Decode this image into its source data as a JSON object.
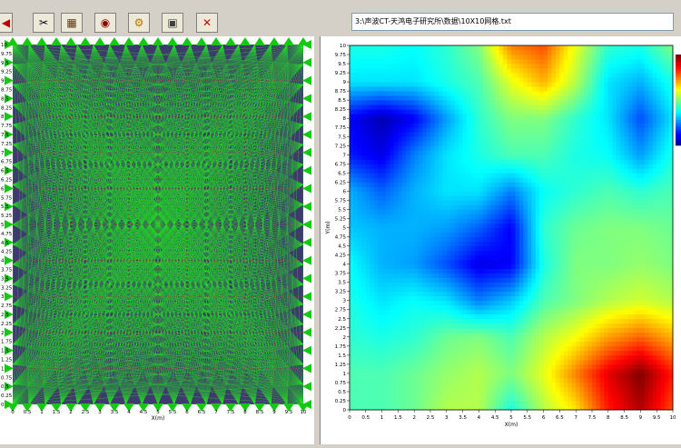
{
  "toolbar": {
    "buttons": [
      {
        "name": "open-file-button",
        "glyph": "≡"
      },
      {
        "name": "tools-button",
        "glyph": "✂"
      },
      {
        "name": "mesh-button",
        "glyph": "▦"
      },
      {
        "name": "contour-button",
        "glyph": "◉"
      },
      {
        "name": "settings-button",
        "glyph": "⚙"
      },
      {
        "name": "export-button",
        "glyph": "▣"
      },
      {
        "name": "close-button",
        "glyph": "✕"
      }
    ],
    "partial_icon_glyph": "◀"
  },
  "path": "3:\\声波CT-天鸿电子研究所\\数据\\10X10网格.txt",
  "colors": {
    "mesh_line": "#22e022",
    "mesh_bg": "#3f3a6e",
    "triangle": "#14c814",
    "grid_dot": "#c04040"
  },
  "chart_data": [
    {
      "type": "scatter",
      "xlabel": "X(m)",
      "ylabel": "",
      "xlim": [
        0,
        10
      ],
      "ylim": [
        0,
        10
      ],
      "x_ticks": [
        "0",
        "0.5",
        "1",
        "1.5",
        "2",
        "2.5",
        "3",
        "3.5",
        "4",
        "4.5",
        "5",
        "5.5",
        "6",
        "6.5",
        "7",
        "7.5",
        "8",
        "8.5",
        "9",
        "9.5",
        "10"
      ],
      "y_ticks": [
        "0",
        "0.25",
        "0.5",
        "0.75",
        "1",
        "1.25",
        "1.5",
        "1.75",
        "2",
        "2.25",
        "2.5",
        "2.75",
        "3",
        "3.25",
        "3.5",
        "3.75",
        "4",
        "4.25",
        "4.5",
        "4.75",
        "5",
        "5.25",
        "5.5",
        "5.75",
        "6",
        "6.25",
        "6.5",
        "6.75",
        "7",
        "7.25",
        "7.5",
        "7.75",
        "8",
        "8.25",
        "8.5",
        "8.75",
        "9",
        "9.25",
        "9.5",
        "9.75",
        "10"
      ],
      "grid": true
    },
    {
      "type": "heatmap",
      "xlabel": "X(m)",
      "ylabel": "Y(m)",
      "xlim": [
        0,
        10
      ],
      "ylim": [
        0,
        10
      ],
      "x_ticks": [
        "0",
        "0.5",
        "1",
        "1.5",
        "2",
        "2.5",
        "3",
        "3.5",
        "4",
        "4.5",
        "5",
        "5.5",
        "6",
        "6.5",
        "7",
        "7.5",
        "8",
        "8.5",
        "9",
        "9.5",
        "10"
      ],
      "y_ticks": [
        "0",
        "0.25",
        "0.5",
        "0.75",
        "1",
        "1.25",
        "1.5",
        "1.75",
        "2",
        "2.25",
        "2.5",
        "2.75",
        "3",
        "3.25",
        "3.5",
        "3.75",
        "4",
        "4.25",
        "4.5",
        "4.75",
        "5",
        "5.25",
        "5.5",
        "5.75",
        "6",
        "6.25",
        "6.5",
        "6.75",
        "7",
        "7.25",
        "7.5",
        "7.75",
        "8",
        "8.25",
        "8.5",
        "8.75",
        "9",
        "9.25",
        "9.5",
        "9.75",
        "10"
      ],
      "grid_x": [
        0,
        1,
        2,
        3,
        4,
        5,
        6,
        7,
        8,
        9,
        10
      ],
      "grid_y": [
        0,
        1,
        2,
        3,
        4,
        5,
        6,
        7,
        8,
        9,
        10
      ],
      "values": [
        [
          0.45,
          0.45,
          0.48,
          0.55,
          0.55,
          0.4,
          0.55,
          0.65,
          0.85,
          0.95,
          0.8
        ],
        [
          0.45,
          0.45,
          0.48,
          0.52,
          0.55,
          0.5,
          0.6,
          0.75,
          0.9,
          1.0,
          0.85
        ],
        [
          0.42,
          0.4,
          0.42,
          0.48,
          0.5,
          0.45,
          0.55,
          0.62,
          0.72,
          0.78,
          0.7
        ],
        [
          0.4,
          0.35,
          0.38,
          0.35,
          0.25,
          0.32,
          0.45,
          0.5,
          0.55,
          0.58,
          0.55
        ],
        [
          0.38,
          0.3,
          0.28,
          0.2,
          0.1,
          0.12,
          0.4,
          0.5,
          0.5,
          0.52,
          0.5
        ],
        [
          0.32,
          0.3,
          0.3,
          0.28,
          0.22,
          0.12,
          0.42,
          0.48,
          0.5,
          0.5,
          0.48
        ],
        [
          0.3,
          0.22,
          0.3,
          0.35,
          0.35,
          0.25,
          0.38,
          0.42,
          0.45,
          0.42,
          0.45
        ],
        [
          0.15,
          0.1,
          0.25,
          0.35,
          0.4,
          0.45,
          0.45,
          0.4,
          0.38,
          0.28,
          0.4
        ],
        [
          0.12,
          0.05,
          0.12,
          0.28,
          0.42,
          0.5,
          0.5,
          0.42,
          0.35,
          0.2,
          0.35
        ],
        [
          0.35,
          0.35,
          0.35,
          0.4,
          0.45,
          0.6,
          0.7,
          0.55,
          0.35,
          0.3,
          0.4
        ],
        [
          0.4,
          0.4,
          0.38,
          0.42,
          0.5,
          0.75,
          0.8,
          0.6,
          0.42,
          0.4,
          0.5
        ]
      ],
      "colormap": "jet"
    }
  ]
}
